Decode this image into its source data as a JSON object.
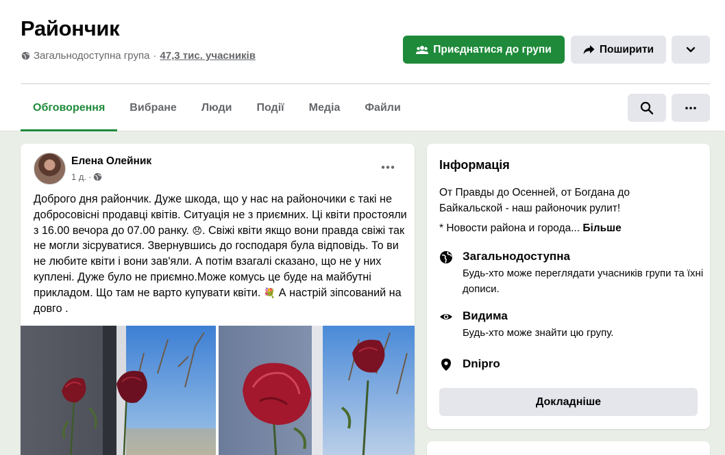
{
  "group": {
    "name": "Райончик",
    "privacy": "Загальнодоступна група",
    "separator": "·",
    "members": "47,3 тис. учасників"
  },
  "actions": {
    "join_label": "Приєднатися до групи",
    "share_label": "Поширити"
  },
  "tabs": [
    {
      "label": "Обговорення",
      "active": true
    },
    {
      "label": "Вибране"
    },
    {
      "label": "Люди"
    },
    {
      "label": "Події"
    },
    {
      "label": "Медіа"
    },
    {
      "label": "Файли"
    }
  ],
  "post": {
    "author": "Елена Олейник",
    "time": "1 д.",
    "time_sep": "·",
    "text_part1": "Доброго дня райончик. Дуже шкода, що у нас на районочики є такі не добросовісні продавці квітів. Ситуація не з приємних. Ці квіти простояли з 16.00 вечора  до 07.00 ранку.",
    "emoji1": "😞",
    "text_part2": ". Свіжі квіти якщо вони правда свіжі так не могли зісруватися. Звернувшись до господаря була відповідь. То ви не любите квіти і вони зав'яли. А потім взагалі сказано, що не у них куплені. Дуже було не приємно.Може  комусь це буде на майбутні прикладом. Що там не варто купувати квіти.",
    "emoji2": "💐",
    "text_part3": " А настрій зіпсований на довго ."
  },
  "info": {
    "title": "Інформація",
    "desc": "От Правды до Осенней, от Богдана до Байкальской - наш районочик рулит!",
    "desc2": "* Новости района и города...",
    "more": "Більше",
    "public_title": "Загальнодоступна",
    "public_sub": "Будь-хто може переглядати учасників групи та їхні дописи.",
    "visible_title": "Видима",
    "visible_sub": "Будь-хто може знайти цю групу.",
    "location": "Dnipro",
    "details_label": "Докладніше"
  },
  "colors": {
    "accent": "#1e8a3a",
    "page_bg": "#e9efe7",
    "button_gray": "#e4e6eb",
    "secondary_text": "#65676b"
  },
  "icons": [
    "globe-icon",
    "people-icon",
    "share-arrow-icon",
    "chevron-down-icon",
    "search-icon",
    "more-dots-icon",
    "eye-icon",
    "location-pin-icon"
  ]
}
